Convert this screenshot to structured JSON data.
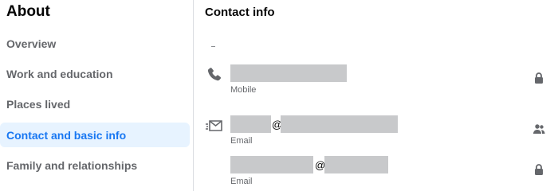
{
  "sidebar": {
    "title": "About",
    "items": [
      {
        "label": "Overview",
        "active": false
      },
      {
        "label": "Work and education",
        "active": false
      },
      {
        "label": "Places lived",
        "active": false
      },
      {
        "label": "Contact and basic info",
        "active": true
      },
      {
        "label": "Family and relationships",
        "active": false
      }
    ]
  },
  "main": {
    "title": "Contact info",
    "entries": [
      {
        "type_icon": "phone-icon",
        "value": "",
        "label": "Mobile",
        "privacy_icon": "lock-icon"
      },
      {
        "type_icon": "envelope-icon",
        "value_separator": "@",
        "label": "Email",
        "privacy_icon": "friends-icon"
      },
      {
        "type_icon": "",
        "value_separator": "@",
        "label": "Email",
        "privacy_icon": "lock-icon"
      }
    ]
  },
  "colors": {
    "accent": "#1877f2",
    "active_bg": "#e7f3ff",
    "muted_text": "#65676b",
    "redaction": "#c8c9cb"
  }
}
